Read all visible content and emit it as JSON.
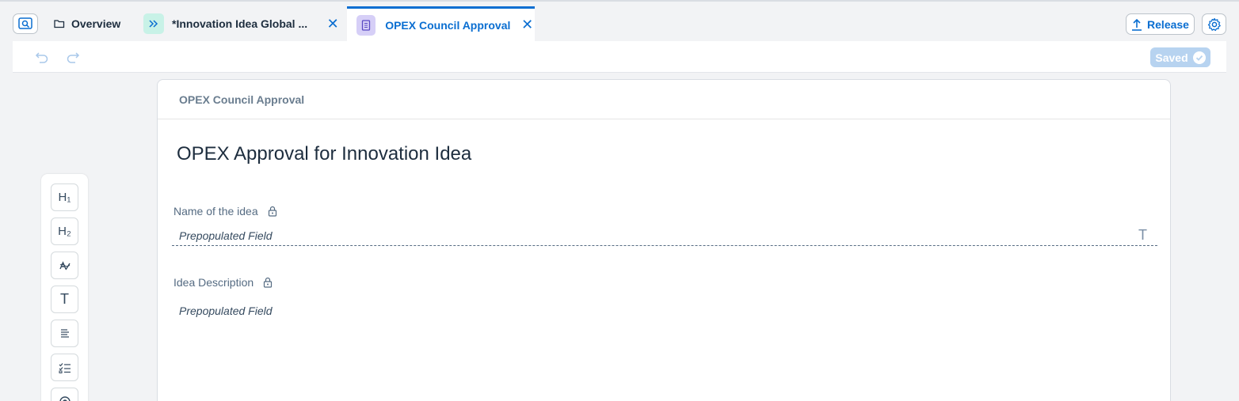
{
  "tabs": {
    "overview": {
      "label": "Overview",
      "icon": "folder-icon"
    },
    "innovation": {
      "label": "*Innovation Idea Global ...",
      "icon": "chevron-forward-icon",
      "badge_color": "#c8f2e7"
    },
    "opex": {
      "label": "OPEX Council Approval",
      "icon": "form-icon",
      "badge_color": "#d6cff7"
    }
  },
  "header": {
    "release_label": "Release",
    "release_icon": "upload-icon",
    "settings_icon": "gear-icon",
    "search_icon": "search-view-icon"
  },
  "toolbar": {
    "saved_label": "Saved",
    "undo_icon": "undo-icon",
    "redo_icon": "redo-icon"
  },
  "palette": [
    {
      "name": "heading1-tool",
      "label": "H₁"
    },
    {
      "name": "heading2-tool",
      "label": "H₂"
    },
    {
      "name": "rich-text-tool",
      "label": ""
    },
    {
      "name": "text-field-tool",
      "label": "T"
    },
    {
      "name": "paragraph-tool",
      "label": ""
    },
    {
      "name": "checklist-tool",
      "label": ""
    },
    {
      "name": "radio-tool",
      "label": ""
    }
  ],
  "form": {
    "header_title": "OPEX Council Approval",
    "title": "OPEX Approval for Innovation Idea",
    "fields": [
      {
        "label": "Name of the idea",
        "value": "Prepopulated Field",
        "locked": true
      },
      {
        "label": "Idea Description",
        "value": "Prepopulated Field",
        "locked": true
      }
    ]
  },
  "colors": {
    "accent": "#0a6ed1",
    "saved_bg": "#b7d3f0"
  }
}
